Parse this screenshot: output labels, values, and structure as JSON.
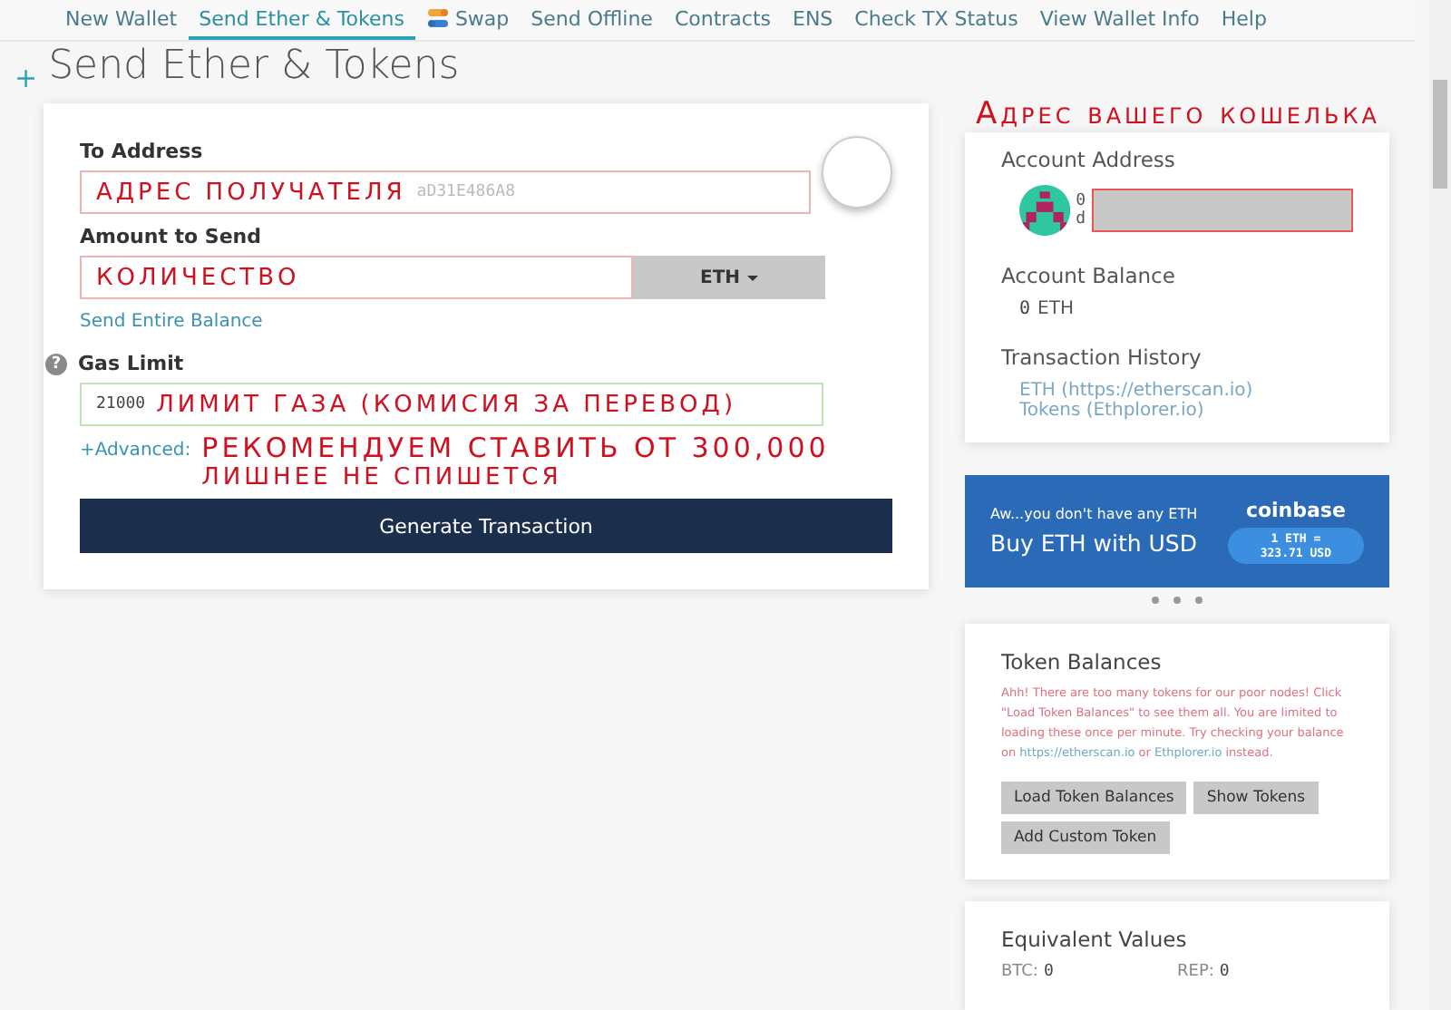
{
  "nav": {
    "tabs": [
      {
        "label": "New Wallet",
        "selected": false,
        "kind": "text"
      },
      {
        "label": "Send Ether & Tokens",
        "selected": true,
        "kind": "text"
      },
      {
        "label": "Swap",
        "selected": false,
        "kind": "icon"
      },
      {
        "label": "Send Offline",
        "selected": false,
        "kind": "text"
      },
      {
        "label": "Contracts",
        "selected": false,
        "kind": "text"
      },
      {
        "label": "ENS",
        "selected": false,
        "kind": "text"
      },
      {
        "label": "Check TX Status",
        "selected": false,
        "kind": "text"
      },
      {
        "label": "View Wallet Info",
        "selected": false,
        "kind": "text"
      },
      {
        "label": "Help",
        "selected": false,
        "kind": "text"
      }
    ]
  },
  "page_title": {
    "expand_glyph": "+",
    "text": "Send Ether & Tokens"
  },
  "send_form": {
    "to_address": {
      "label": "To Address",
      "annotation": "АДРЕС ПОЛУЧАТЕЛЯ",
      "placeholder_tail": "aD31E486A8"
    },
    "amount": {
      "label": "Amount to Send",
      "annotation": "КОЛИЧЕСТВО",
      "currency": "ETH"
    },
    "send_entire_balance": "Send Entire Balance",
    "gas_limit": {
      "help_glyph": "?",
      "label": "Gas Limit",
      "value": "21000",
      "annotation": "ЛИМИТ ГАЗА (КОМИСИЯ ЗА ПЕРЕВОД)"
    },
    "advanced_link": "+Advanced:",
    "gas_note": [
      "РЕКОМЕНДУЕМ СТАВИТЬ ОТ 300,000",
      "ЛИШНЕЕ НЕ СПИШЕТСЯ"
    ],
    "generate_button": "Generate Transaction"
  },
  "wallet_annotation": "Адрес вашего кошелька",
  "account": {
    "address_title": "Account Address",
    "address_fragments": [
      "0",
      "d"
    ],
    "balance_title": "Account Balance",
    "balance_value": "0",
    "balance_unit": "ETH",
    "history_title": "Transaction History",
    "history_links": [
      "ETH (https://etherscan.io)",
      "Tokens (Ethplorer.io)"
    ]
  },
  "banner": {
    "subtitle": "Aw...you don't have any ETH",
    "title": "Buy ETH with USD",
    "brand": "coinbase",
    "rate": [
      "1 ETH =",
      "323.71 USD"
    ]
  },
  "token_balances": {
    "title": "Token Balances",
    "message": [
      {
        "kind": "text",
        "text": "Ahh! There are too many tokens for our poor nodes! Click \"Load Token Balances\" to see them all. You are limited to loading these once per minute. Try checking your balance on "
      },
      {
        "kind": "link",
        "text": "https://etherscan.io"
      },
      {
        "kind": "text",
        "text": " or "
      },
      {
        "kind": "link",
        "text": "Ethplorer.io"
      },
      {
        "kind": "text",
        "text": " instead."
      }
    ],
    "buttons": [
      "Load Token Balances",
      "Show Tokens",
      "Add Custom Token"
    ]
  },
  "equivalent_values": {
    "title": "Equivalent Values",
    "items": [
      {
        "label": "BTC:",
        "value": "0"
      },
      {
        "label": "REP:",
        "value": "0"
      }
    ]
  }
}
